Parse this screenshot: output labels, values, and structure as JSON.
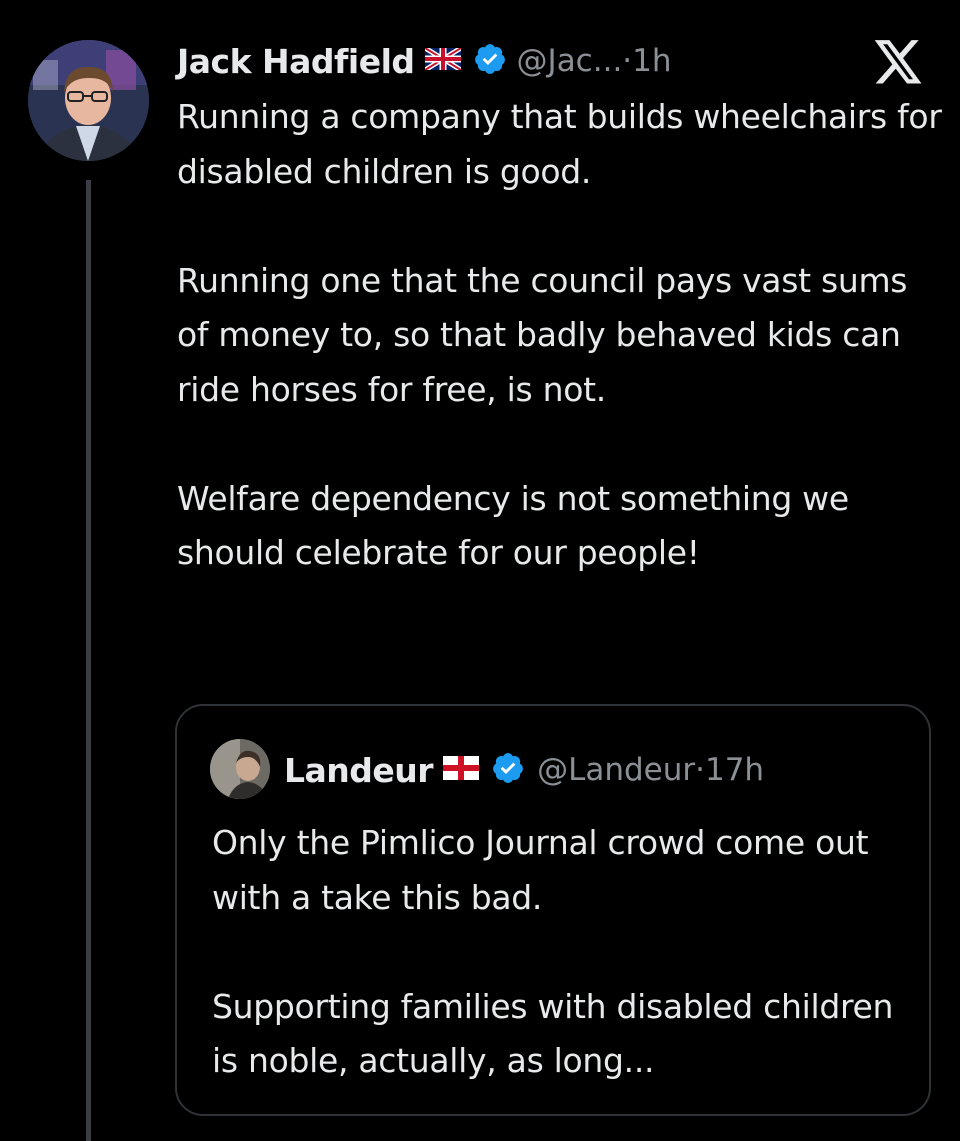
{
  "tweet": {
    "author": {
      "name": "Jack Hadfield",
      "flag_icon": "uk-flag-icon",
      "verified_icon": "verified-badge-icon",
      "handle": "@Jac...",
      "separator": "·",
      "time": "1h"
    },
    "platform_icon": "x-logo-icon",
    "paragraphs": [
      "Running a company that builds wheelchairs for disabled children is good.",
      "Running one that the council pays vast sums of money to, so that badly behaved kids can ride horses for free, is not.",
      "Welfare dependency is not something we should celebrate for our people!"
    ]
  },
  "quoted_tweet": {
    "author": {
      "name": "Landeur",
      "flag_icon": "england-flag-icon",
      "verified_icon": "verified-badge-icon",
      "handle": "@Landeur",
      "separator": "·",
      "time": "17h"
    },
    "paragraphs": [
      "Only the Pimlico Journal crowd come out with a take this bad.",
      "Supporting families with disabled children is noble, actually, as long..."
    ]
  },
  "colors": {
    "background": "#000000",
    "text": "#e7e9ea",
    "secondary_text": "#8b9095",
    "verified_blue": "#1d9bf0",
    "border": "#2f3336",
    "thread_line": "#3a3d41"
  }
}
